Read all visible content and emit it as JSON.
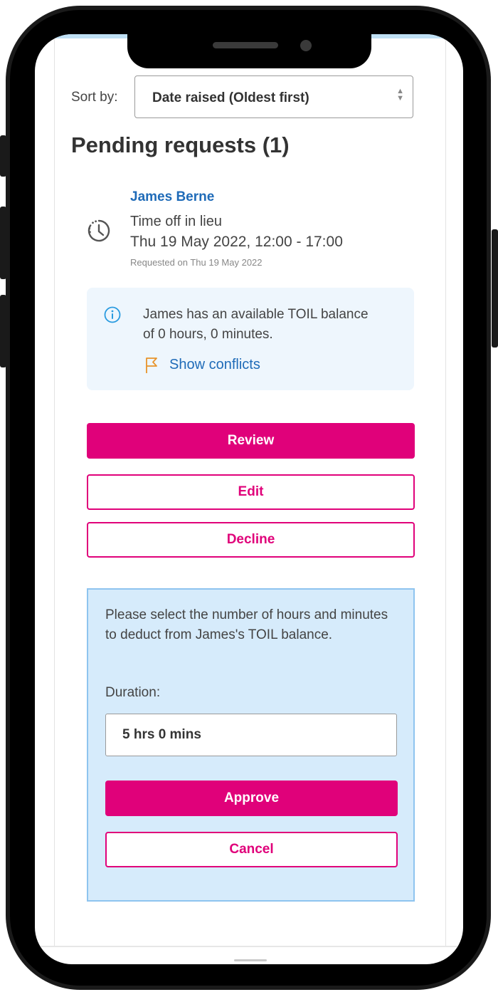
{
  "sort": {
    "label": "Sort by:",
    "selected": "Date raised (Oldest first)"
  },
  "pending": {
    "title": "Pending requests (1)"
  },
  "request": {
    "name": "James Berne",
    "type": "Time off in lieu",
    "when": "Thu 19 May 2022, 12:00 - 17:00",
    "requested_on": "Requested on Thu 19 May 2022",
    "icon": "clock-icon"
  },
  "info": {
    "icon": "info-icon",
    "text": "James has an available TOIL balance of 0 hours, 0 minutes.",
    "conflicts_icon": "flag-icon",
    "conflicts_label": "Show conflicts"
  },
  "actions": {
    "review": "Review",
    "edit": "Edit",
    "decline": "Decline"
  },
  "approve_panel": {
    "message": "Please select the number of hours and minutes to deduct from James's TOIL balance.",
    "duration_label": "Duration:",
    "duration_value": "5 hrs 0 mins",
    "approve": "Approve",
    "cancel": "Cancel"
  },
  "colors": {
    "accent": "#e0017a",
    "link": "#1f6bb8",
    "info_bg": "#eef6fd",
    "panel_bg": "#d6ebfb",
    "panel_border": "#8ec4ef"
  }
}
